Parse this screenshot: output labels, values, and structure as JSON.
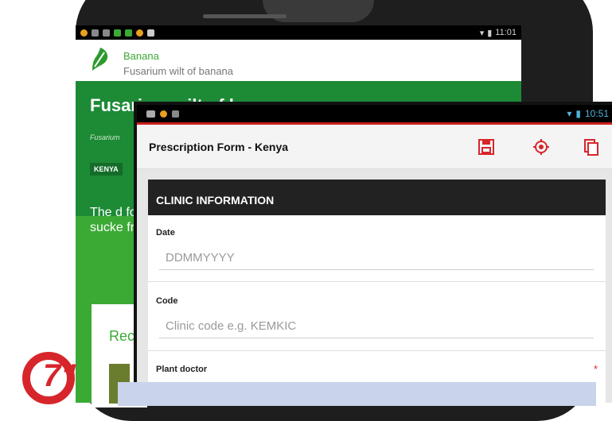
{
  "back_app": {
    "status_time": "11:01",
    "crop_name": "Banana",
    "disease_subtitle": "Fusarium wilt of banana",
    "title": "Fusarium wilt of banana",
    "latin_fragment": "Fusarium",
    "country_badge": "KENYA",
    "description_fragment": "The d for m sucke from",
    "card_heading": "Rec"
  },
  "badge_text": "7\"",
  "front_app": {
    "status_time": "10:51",
    "form_title": "Prescription Form - Kenya",
    "toolbar": {
      "save_icon": "save-icon",
      "location_icon": "location-icon",
      "copy_icon": "copy-icon"
    },
    "section_title": "CLINIC INFORMATION",
    "fields": [
      {
        "label": "Date",
        "placeholder": "DDMMYYYY",
        "value": ""
      },
      {
        "label": "Code",
        "placeholder": "Clinic code e.g. KEMKIC",
        "value": ""
      },
      {
        "label": "Plant doctor",
        "required_mark": "*"
      }
    ]
  },
  "colors": {
    "brand_green": "#3aaa35",
    "dark_green": "#1d8a36",
    "accent_red": "#d7262b",
    "status_blue": "#4fb2d6"
  }
}
